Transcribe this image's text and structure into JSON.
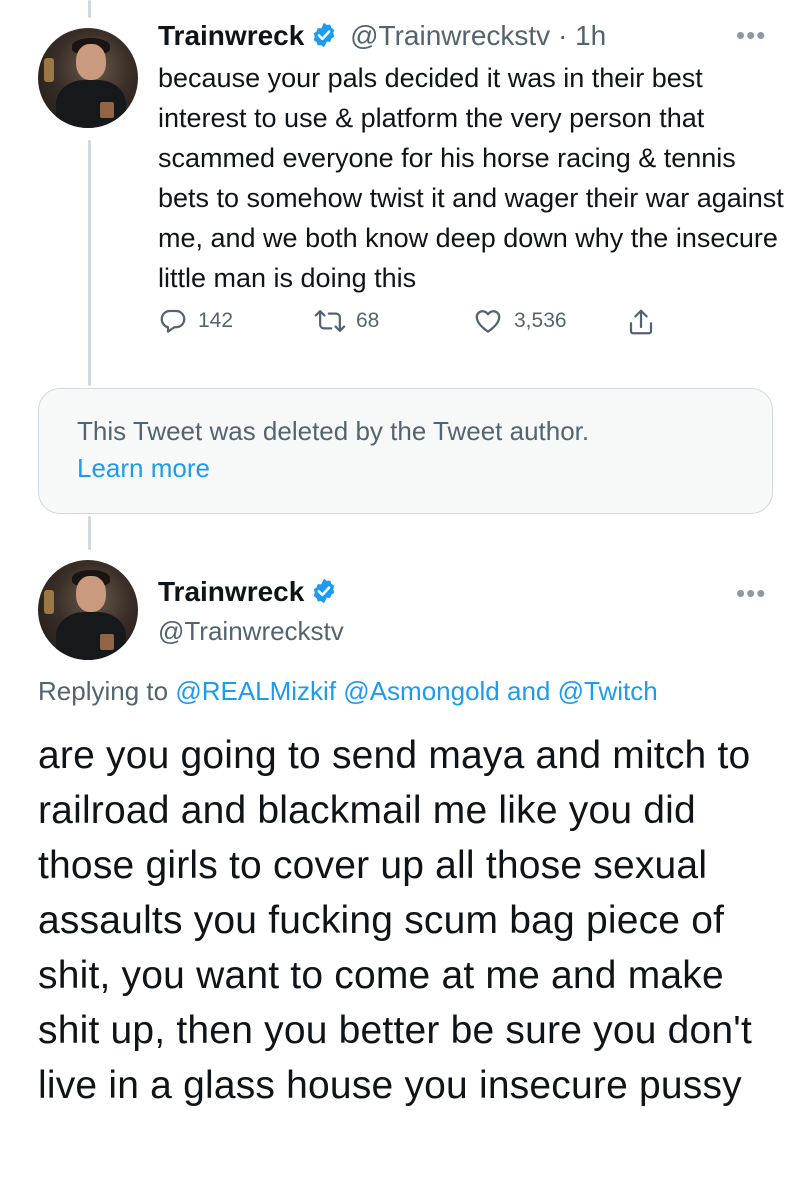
{
  "tweet1": {
    "author_name": "Trainwreck",
    "author_handle": "@Trainwreckstv",
    "separator": "·",
    "time": "1h",
    "text": "because your pals decided it was in their best interest to use & platform the very person that scammed everyone for his horse racing & tennis bets to somehow twist it and wager their war against me, and we both know deep down why the insecure little man is doing this",
    "replies": "142",
    "retweets": "68",
    "likes": "3,536"
  },
  "deleted_tweet": {
    "message": "This Tweet was deleted by the Tweet author.",
    "link_label": "Learn more"
  },
  "tweet2": {
    "author_name": "Trainwreck",
    "author_handle": "@Trainwreckstv",
    "replying_prefix": "Replying to",
    "mention1": "@REALMizkif",
    "mention2": "@Asmongold",
    "and_text": "and",
    "mention3": "@Twitch",
    "text": "are you going to send maya and mitch to railroad and blackmail me like you did those girls to cover up all those sexual assaults you fucking scum bag piece of shit, you want to come at me and make shit up, then you better be sure you don't live in a glass house you insecure pussy"
  },
  "icons": {
    "verified": "verified-badge-icon",
    "more": "more-options-icon",
    "reply": "reply-icon",
    "retweet": "retweet-icon",
    "like": "like-icon",
    "share": "share-icon"
  },
  "colors": {
    "link": "#1d9bf0",
    "muted": "#536471",
    "text": "#0f1419",
    "thread_line": "#cfd9de",
    "deleted_bg": "#f7f9f9"
  }
}
